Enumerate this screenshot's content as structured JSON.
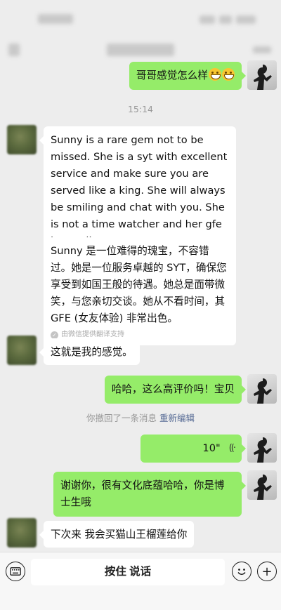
{
  "chat": {
    "messages": [
      {
        "side": "right",
        "text": "哥哥感觉怎么样"
      },
      {
        "text": "15:14"
      },
      {
        "side": "left",
        "text": "Sunny is a rare gem not to be missed. She is a syt with excellent service and make sure you are served like a king. She will always be smiling and chat with you. She is not a time watcher and her gfe is excellent."
      },
      {
        "text": "Sunny 是一位难得的瑰宝，不容错过。她是一位服务卓越的 SYT，确保您享受到如国王般的待遇。她总是面带微笑，与您亲切交谈。她从不看时间，其 GFE (女友体验) 非常出色。",
        "footer": "由微信提供翻译支持"
      },
      {
        "side": "left",
        "text": "这就是我的感觉。"
      },
      {
        "side": "right",
        "text": "哈哈，这么高评价吗！宝贝"
      },
      {
        "text": "你撤回了一条消息",
        "link": "重新编辑"
      },
      {
        "side": "right",
        "duration": "10\"",
        "wave": "((·"
      },
      {
        "side": "right",
        "text": "谢谢你，很有文化底蕴哈哈，你是博士生哦"
      },
      {
        "side": "left",
        "text": "下次来 我会买猫山王榴莲给你"
      }
    ]
  },
  "input_bar": {
    "hold_label": "按住 说话",
    "add_glyph": "+"
  },
  "colors": {
    "background": "#ededed",
    "incoming_bubble": "#ffffff",
    "outgoing_bubble": "#95ec69",
    "link": "#576b95"
  },
  "icons": {
    "keyboard": "keyboard-icon",
    "emoji": "emoji-icon",
    "add": "plus-icon",
    "voice_wave": "voice-wave-icon",
    "translate_check": "check-icon"
  }
}
